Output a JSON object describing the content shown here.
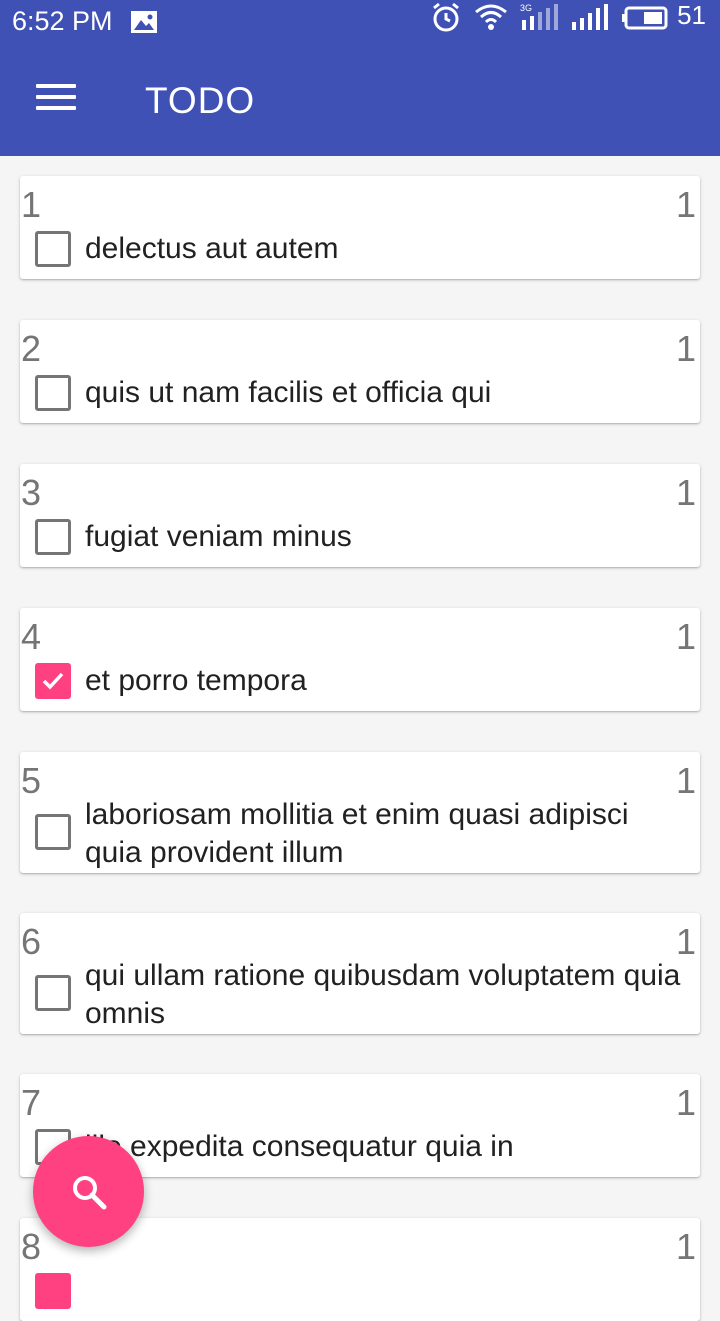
{
  "status_bar": {
    "time": "6:52 PM",
    "battery": "51",
    "network": "3G"
  },
  "app_bar": {
    "title": "TODO"
  },
  "todos": [
    {
      "id": "1",
      "user": "1",
      "title": "delectus aut autem",
      "completed": false
    },
    {
      "id": "2",
      "user": "1",
      "title": "quis ut nam facilis et officia qui",
      "completed": false
    },
    {
      "id": "3",
      "user": "1",
      "title": "fugiat veniam minus",
      "completed": false
    },
    {
      "id": "4",
      "user": "1",
      "title": "et porro tempora",
      "completed": true
    },
    {
      "id": "5",
      "user": "1",
      "title": "laboriosam mollitia et enim quasi adipisci quia provident illum",
      "completed": false
    },
    {
      "id": "6",
      "user": "1",
      "title": "qui ullam ratione quibusdam voluptatem quia omnis",
      "completed": false
    },
    {
      "id": "7",
      "user": "1",
      "title": "illo expedita consequatur quia in",
      "completed": false
    },
    {
      "id": "8",
      "user": "1",
      "title": "",
      "completed": true
    }
  ],
  "colors": {
    "primary": "#3f51b5",
    "accent": "#ff4081"
  },
  "icons": {
    "menu": "hamburger-menu-icon",
    "search": "search-icon",
    "check": "checkmark-icon"
  }
}
